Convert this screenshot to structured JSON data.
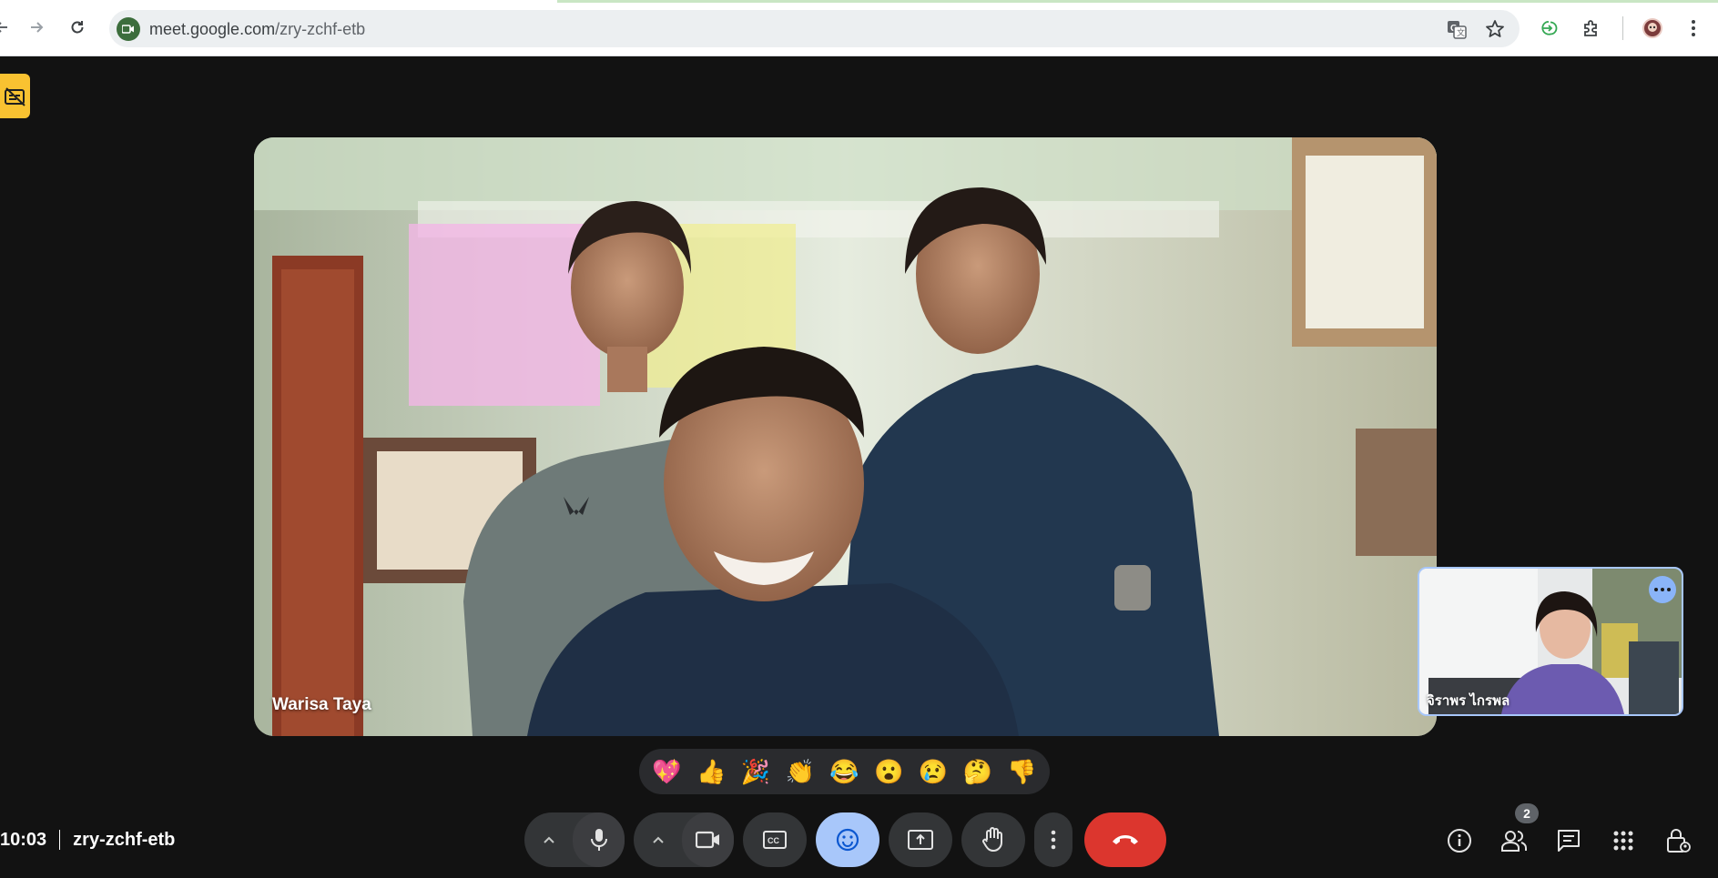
{
  "browser": {
    "url_domain": "meet.google.com",
    "url_path": "/zry-zchf-etb",
    "icons": [
      "back-icon",
      "forward-icon",
      "reload-icon",
      "meet-site-icon",
      "translate-icon",
      "bookmark-star-icon",
      "sign-in-icon",
      "extensions-icon",
      "profile-avatar",
      "chrome-menu-icon"
    ]
  },
  "stage": {
    "main_participant_name": "Warisa Taya",
    "self_participant_name": "จิราพร ไกรพล",
    "accent_color": "#a8c7fa"
  },
  "reactions": [
    "💖",
    "👍",
    "🎉",
    "👏",
    "😂",
    "😮",
    "😢",
    "🤔",
    "👎"
  ],
  "bottom_bar": {
    "time": "10:03",
    "meeting_code": "zry-zchf-etb",
    "participant_count": "2",
    "controls": [
      "audio-options",
      "microphone",
      "video-options",
      "camera",
      "captions",
      "reactions",
      "present",
      "raise-hand",
      "more-options",
      "leave-call"
    ],
    "side_controls": [
      "meeting-details",
      "people",
      "chat",
      "activities",
      "host-controls"
    ],
    "leave_color": "#dc362e"
  }
}
